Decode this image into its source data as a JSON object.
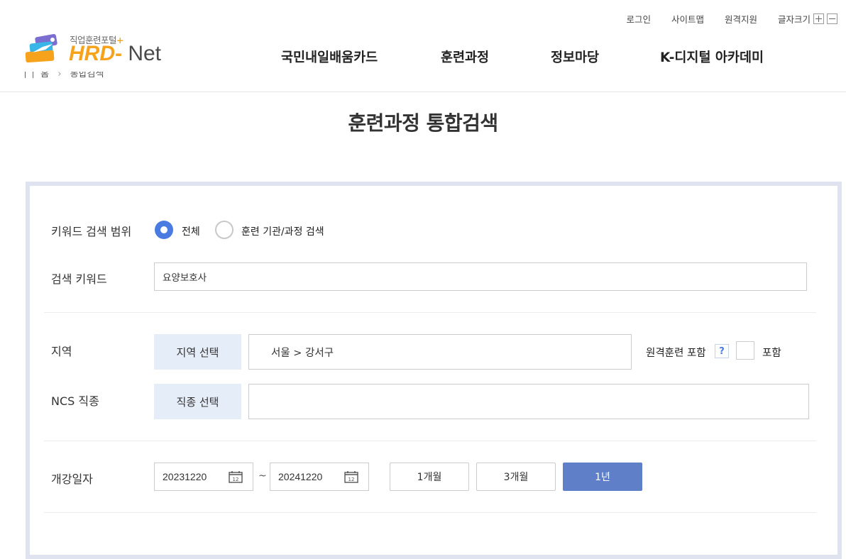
{
  "util": {
    "login": "로그인",
    "sitemap": "사이트맵",
    "remote": "원격지원",
    "font_size": "글자크기"
  },
  "logo": {
    "tagline": "직업훈련포털",
    "plus": "+",
    "hrd": "HRD",
    "dash": "-",
    "net": " Net"
  },
  "gnb": [
    "국민내일배움카드",
    "훈련과정",
    "정보마당",
    "K-디지털 아카데미"
  ],
  "breadcrumb": {
    "home": "홈",
    "sep": "›",
    "current": "통합검색"
  },
  "page_title": "훈련과정 통합검색",
  "form": {
    "keyword_scope": {
      "label": "키워드 검색 범위",
      "options": [
        "전체",
        "훈련 기관/과정 검색"
      ],
      "selected": "전체"
    },
    "keyword": {
      "label": "검색 키워드",
      "value": "요양보호사"
    },
    "region": {
      "label": "지역",
      "button": "지역 선택",
      "value": "서울 > 강서구"
    },
    "remote": {
      "label": "원격훈련 포함",
      "help": "?",
      "check_label": "포함"
    },
    "ncs": {
      "label": "NCS 직종",
      "button": "직종 선택",
      "value": ""
    },
    "date": {
      "label": "개강일자",
      "start": "20231220",
      "end": "20241220",
      "tilde": "~",
      "calendar_day": "12",
      "periods": [
        "1개월",
        "3개월",
        "1년"
      ],
      "active_period": "1년"
    }
  },
  "colors": {
    "accent": "#4a7be0",
    "active_button": "#5f80c8",
    "select_button_bg": "#e5edf8",
    "box_border": "#dfe3ef",
    "logo_orange": "#f7a21b"
  }
}
